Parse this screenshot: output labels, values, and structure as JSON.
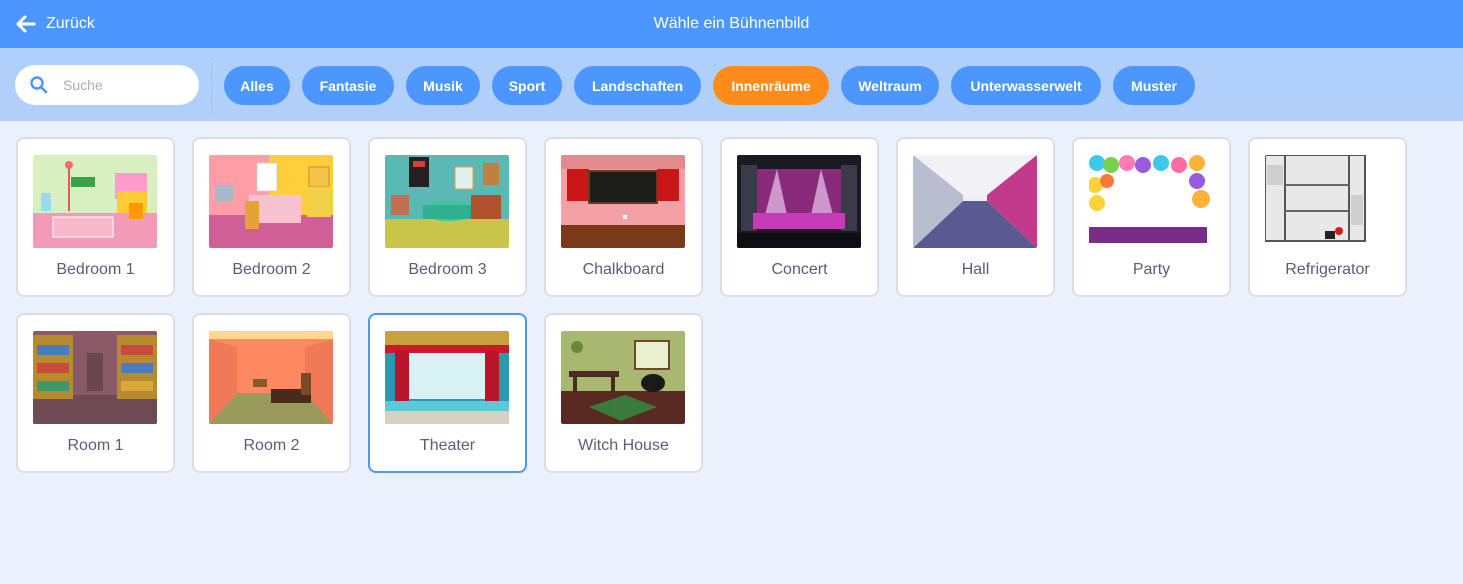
{
  "header": {
    "back_label": "Zurück",
    "title": "Wähle ein Bühnenbild"
  },
  "search": {
    "placeholder": "Suche",
    "value": ""
  },
  "tags": [
    "Alles",
    "Fantasie",
    "Musik",
    "Sport",
    "Landschaften",
    "Innenräume",
    "Weltraum",
    "Unterwasserwelt",
    "Muster"
  ],
  "active_tag": "Innenräume",
  "backdrops": [
    {
      "name": "Bedroom 1"
    },
    {
      "name": "Bedroom 2"
    },
    {
      "name": "Bedroom 3"
    },
    {
      "name": "Chalkboard"
    },
    {
      "name": "Concert"
    },
    {
      "name": "Hall"
    },
    {
      "name": "Party"
    },
    {
      "name": "Refrigerator"
    },
    {
      "name": "Room 1"
    },
    {
      "name": "Room 2"
    },
    {
      "name": "Theater",
      "selected": true
    },
    {
      "name": "Witch House"
    }
  ],
  "colors": {
    "header": "#4c97ff",
    "filter_bar": "#b1cffb",
    "tag": "#4c97ff",
    "tag_active": "#ff8c1a",
    "background": "#e9f1fc",
    "text": "#575e75"
  }
}
